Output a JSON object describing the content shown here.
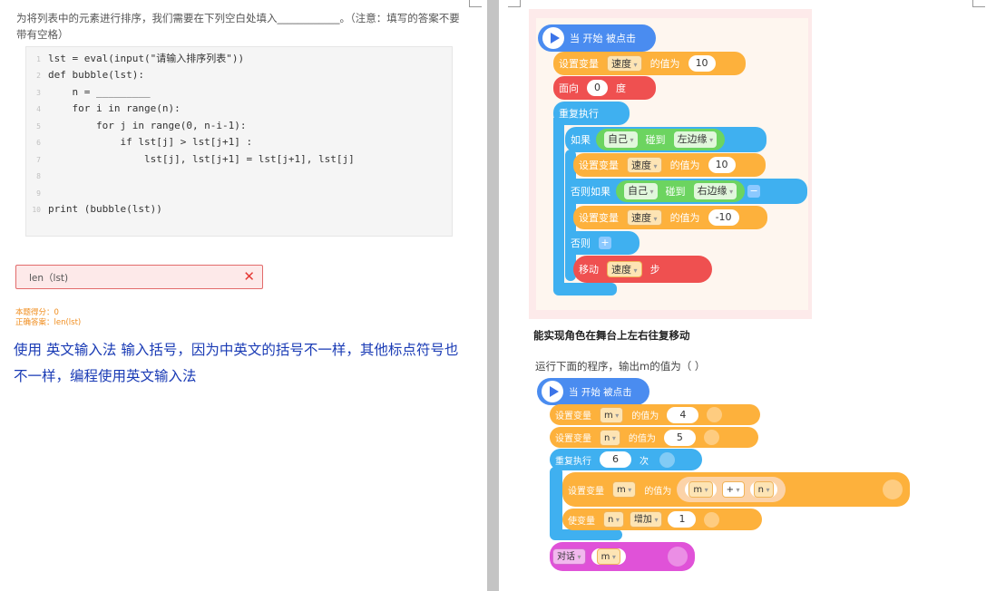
{
  "question": {
    "text": "为将列表中的元素进行排序，我们需要在下列空白处填入____________。（注意：填写的答案不要带有空格）"
  },
  "code": {
    "lines": [
      {
        "n": "1",
        "text": "lst = eval(input(\"请输入排序列表\"))"
      },
      {
        "n": "2",
        "text": "def bubble(lst):"
      },
      {
        "n": "3",
        "text": "    n = _________"
      },
      {
        "n": "4",
        "text": "    for i in range(n):"
      },
      {
        "n": "5",
        "text": "        for j in range(0, n-i-1):"
      },
      {
        "n": "6",
        "text": "            if lst[j] > lst[j+1] :"
      },
      {
        "n": "7",
        "text": "                lst[j], lst[j+1] = lst[j+1], lst[j]"
      },
      {
        "n": "8",
        "text": ""
      },
      {
        "n": "9",
        "text": ""
      },
      {
        "n": "10",
        "text": "print (bubble(lst))"
      }
    ]
  },
  "answer": {
    "user_answer": "len（lst)",
    "clear_symbol": "✕",
    "score_label": "本题得分：0",
    "correct_label": "正确答案：len(lst)"
  },
  "note": "使用 英文输入法 输入括号，因为中英文的括号不一样，其他标点符号也不一样，编程使用英文输入法",
  "prog1": {
    "hat": "当 开始 被点击",
    "set1": {
      "label": "设置变量",
      "var": "速度",
      "of": "的值为",
      "val": "10"
    },
    "face": {
      "label": "面向",
      "val": "0",
      "unit": "度"
    },
    "forever": "重复执行",
    "if": {
      "label": "如果",
      "sprite": "自己",
      "touch": "碰到",
      "edge": "左边缘"
    },
    "set2": {
      "label": "设置变量",
      "var": "速度",
      "of": "的值为",
      "val": "10"
    },
    "elif": {
      "label": "否则如果",
      "sprite": "自己",
      "touch": "碰到",
      "edge": "右边缘",
      "minus": "−"
    },
    "set3": {
      "label": "设置变量",
      "var": "速度",
      "of": "的值为",
      "val": "-10"
    },
    "else": {
      "label": "否则",
      "plus": "+"
    },
    "move": {
      "label": "移动",
      "var": "速度",
      "unit": "步"
    },
    "caption": "能实现角色在舞台上左右往复移动"
  },
  "prog2": {
    "question": "运行下面的程序，输出m的值为（ ）",
    "hat": "当 开始 被点击",
    "set_m": {
      "label": "设置变量",
      "var": "m",
      "of": "的值为",
      "val": "4"
    },
    "set_n": {
      "label": "设置变量",
      "var": "n",
      "of": "的值为",
      "val": "5"
    },
    "repeat": {
      "label": "重复执行",
      "val": "6",
      "unit": "次"
    },
    "set_sum": {
      "label": "设置变量",
      "var": "m",
      "of": "的值为",
      "a": "m",
      "op": "+",
      "b": "n"
    },
    "change": {
      "label": "使变量",
      "var": "n",
      "op": "增加",
      "val": "1"
    },
    "say": {
      "label": "对话",
      "var": "m"
    }
  },
  "colors": {
    "event": "#4a8cf0",
    "control": "#3fb0f0",
    "variable": "#fdb13c",
    "motion": "#ef5050",
    "sensing": "#6cd460",
    "looks": "#e052d8",
    "note": "#1a3bb5",
    "score": "#f08c1c"
  }
}
